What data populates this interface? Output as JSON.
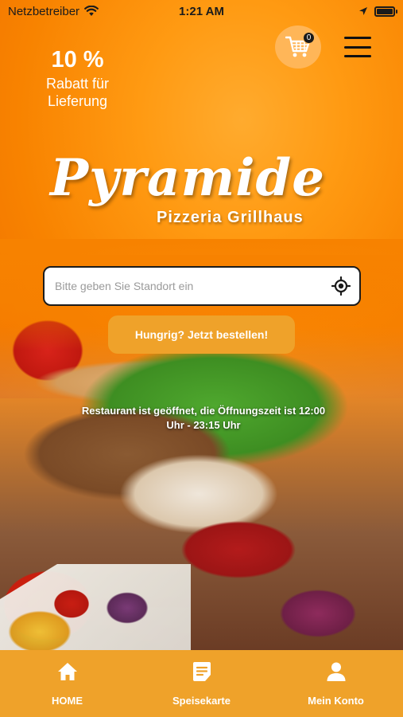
{
  "status_bar": {
    "carrier": "Netzbetreiber",
    "time": "1:21 AM"
  },
  "promo": {
    "value": "10 %",
    "label_line1": "Rabatt für",
    "label_line2": "Lieferung"
  },
  "header": {
    "cart_count": "0",
    "cart_icon": "shopping-cart-icon",
    "menu_icon": "hamburger-menu-icon"
  },
  "logo": {
    "name": "Pyramide",
    "subtitle": "Pizzeria Grillhaus"
  },
  "location": {
    "placeholder": "Bitte geben Sie Standort ein",
    "value": "",
    "icon": "locate-icon"
  },
  "order_button": {
    "label": "Hungrig? Jetzt bestellen!"
  },
  "opening_hours": {
    "line1": "Restaurant ist geöffnet, die Öffnungszeit ist 12:00",
    "line2": "Uhr - 23:15 Uhr"
  },
  "bottom_nav": {
    "items": [
      {
        "label": "HOME",
        "icon": "home-icon"
      },
      {
        "label": "Speisekarte",
        "icon": "menu-card-icon"
      },
      {
        "label": "Mein Konto",
        "icon": "user-icon"
      }
    ]
  },
  "colors": {
    "brand_orange": "#f88300",
    "button_amber": "#efa22a",
    "cart_circle": "#ffb658"
  }
}
